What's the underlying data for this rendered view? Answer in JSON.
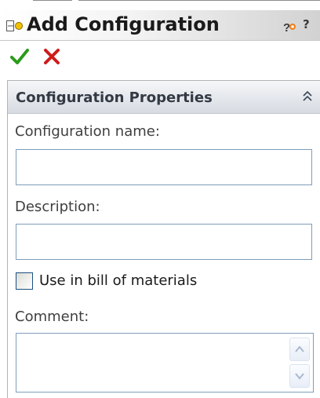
{
  "window": {
    "title": "Add Configuration",
    "help_label": "?"
  },
  "toolbar": {
    "ok_icon": "check-icon",
    "cancel_icon": "close-icon",
    "colors": {
      "ok": "#2a9b1c",
      "cancel": "#cf1b1b"
    }
  },
  "panel": {
    "header": "Configuration Properties",
    "collapse_icon": "double-chevron-up-icon",
    "config_name_label": "Configuration name:",
    "config_name_value": "",
    "description_label": "Description:",
    "description_value": "",
    "bom_checkbox_label": "Use in bill of materials",
    "bom_checked": false,
    "comment_label": "Comment:",
    "comment_value": ""
  }
}
